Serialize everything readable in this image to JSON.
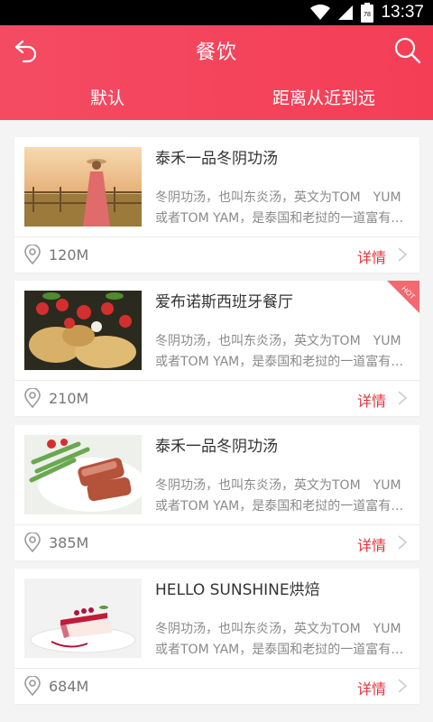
{
  "status_bar": {
    "time": "13:37",
    "battery": "78"
  },
  "header": {
    "title": "餐饮",
    "tabs": [
      {
        "label": "默认"
      },
      {
        "label": "距离从近到远"
      }
    ]
  },
  "items": [
    {
      "name": "泰禾一品冬阴功汤",
      "desc_line1": "冬阴功汤，也叫东炎汤，英文为TOM　YUM",
      "desc_line2": "或者TOM YAM，是泰国和老挝的一道富有…",
      "distance": "120M",
      "details": "详情"
    },
    {
      "name": "爱布诺斯西班牙餐厅",
      "desc_line1": "冬阴功汤，也叫东炎汤，英文为TOM　YUM",
      "desc_line2": "或者TOM YAM，是泰国和老挝的一道富有…",
      "distance": "210M",
      "details": "详情",
      "badge": "HOT"
    },
    {
      "name": "泰禾一品冬阴功汤",
      "desc_line1": "冬阴功汤，也叫东炎汤，英文为TOM　YUM",
      "desc_line2": "或者TOM YAM，是泰国和老挝的一道富有…",
      "distance": "385M",
      "details": "详情"
    },
    {
      "name": "HELLO SUNSHINE烘焙",
      "desc_line1": "冬阴功汤，也叫东炎汤，英文为TOM　YUM",
      "desc_line2": "或者TOM YAM，是泰国和老挝的一道富有…",
      "distance": "684M",
      "details": "详情"
    }
  ],
  "colors": {
    "header": "#f44b63",
    "accent": "#e5333b"
  },
  "icons": [
    "back-icon",
    "search-icon",
    "location-pin-icon",
    "chevron-right-icon",
    "wifi-icon",
    "signal-icon",
    "battery-icon"
  ]
}
